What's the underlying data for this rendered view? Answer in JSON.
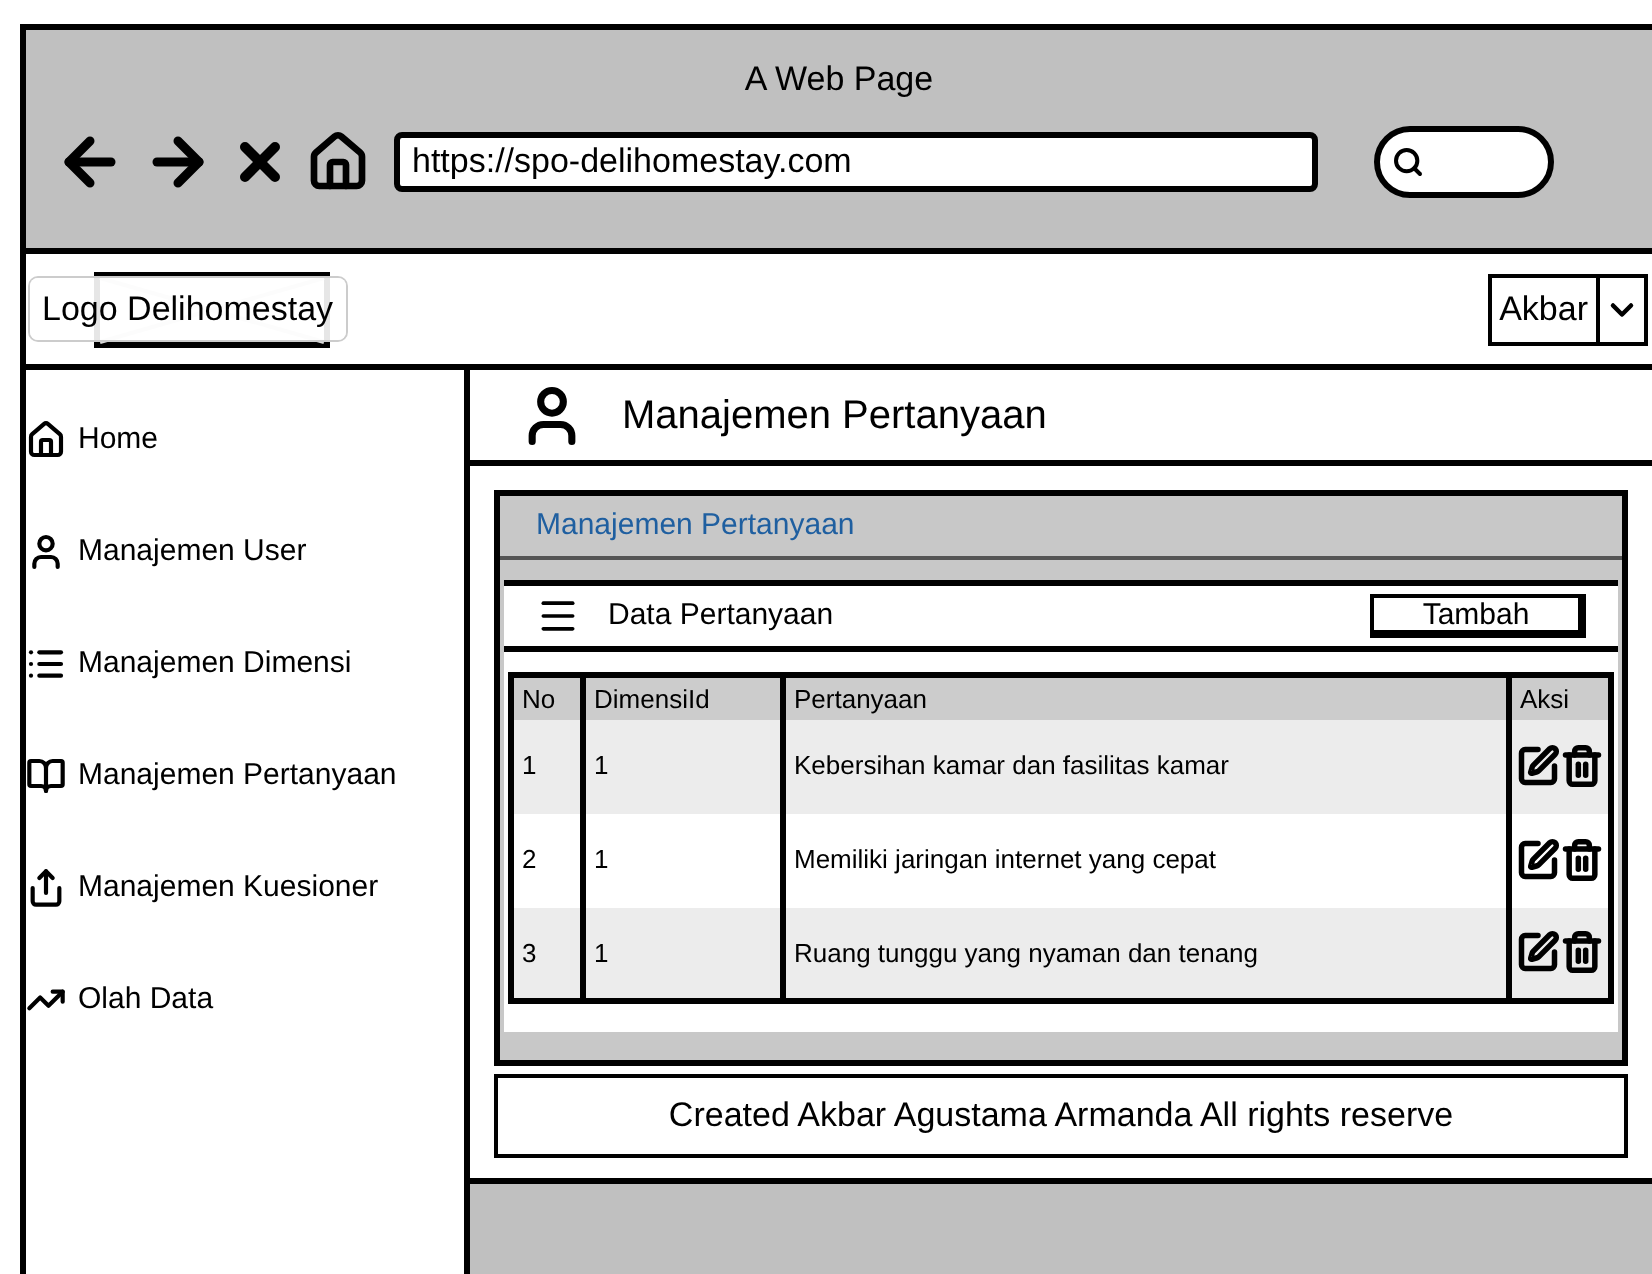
{
  "window": {
    "title": "A Web Page",
    "url": "https://spo-delihomestay.com"
  },
  "header": {
    "logo": "Logo Delihomestay",
    "user": "Akbar"
  },
  "sidebar": {
    "items": [
      {
        "label": "Home",
        "kind": "home"
      },
      {
        "label": "Manajemen User",
        "kind": "user"
      },
      {
        "label": "Manajemen Dimensi",
        "kind": "list"
      },
      {
        "label": "Manajemen Pertanyaan",
        "kind": "book"
      },
      {
        "label": "Manajemen Kuesioner",
        "kind": "share"
      },
      {
        "label": "Olah Data",
        "kind": "chart"
      }
    ]
  },
  "page": {
    "title": "Manajemen Pertanyaan"
  },
  "panel": {
    "title": "Manajemen Pertanyaan",
    "subtitle": "Data Pertanyaan",
    "add_button": "Tambah"
  },
  "table": {
    "columns": [
      "No",
      "DimensiId",
      "Pertanyaan",
      "Aksi"
    ],
    "rows": [
      {
        "no": "1",
        "dimensi": "1",
        "pertanyaan": "Kebersihan kamar dan fasilitas kamar"
      },
      {
        "no": "2",
        "dimensi": "1",
        "pertanyaan": "Memiliki jaringan internet yang cepat"
      },
      {
        "no": "3",
        "dimensi": "1",
        "pertanyaan": "Ruang tunggu yang nyaman dan tenang"
      }
    ]
  },
  "footer": "Created Akbar Agustama Armanda All rights reserve"
}
